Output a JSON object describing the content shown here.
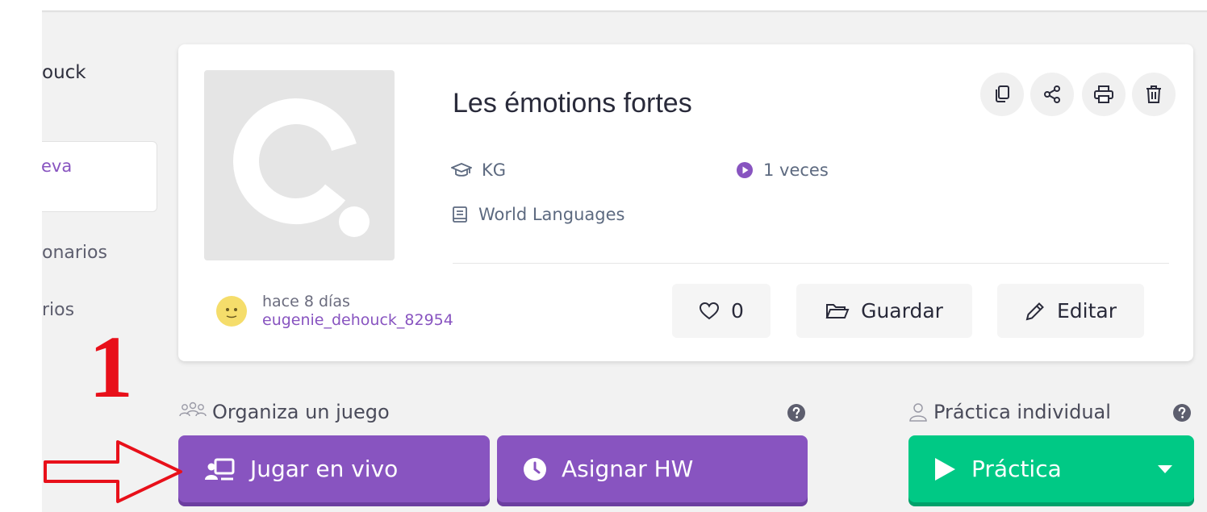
{
  "sidebar": {
    "items": [
      {
        "label": "ouck"
      },
      {
        "label": "eva"
      },
      {
        "label": "onarios"
      },
      {
        "label": "rios"
      }
    ]
  },
  "quiz": {
    "title": "Les émotions fortes",
    "grade": "KG",
    "plays": "1 veces",
    "subject": "World Languages",
    "created": "hace 8 días",
    "author": "eugenie_dehouck_82954",
    "likes": "0",
    "save_label": "Guardar",
    "edit_label": "Editar",
    "icons": [
      "copy-icon",
      "share-icon",
      "print-icon",
      "delete-icon"
    ]
  },
  "host_section": {
    "label": "Organiza un juego",
    "live_label": "Jugar en vivo",
    "homework_label": "Asignar HW"
  },
  "practice_section": {
    "label": "Práctica individual",
    "practice_label": "Práctica"
  },
  "annotation": {
    "step": "1"
  },
  "colors": {
    "purple": "#8854c0",
    "green": "#00c985",
    "annotation_red": "#e8101a"
  }
}
